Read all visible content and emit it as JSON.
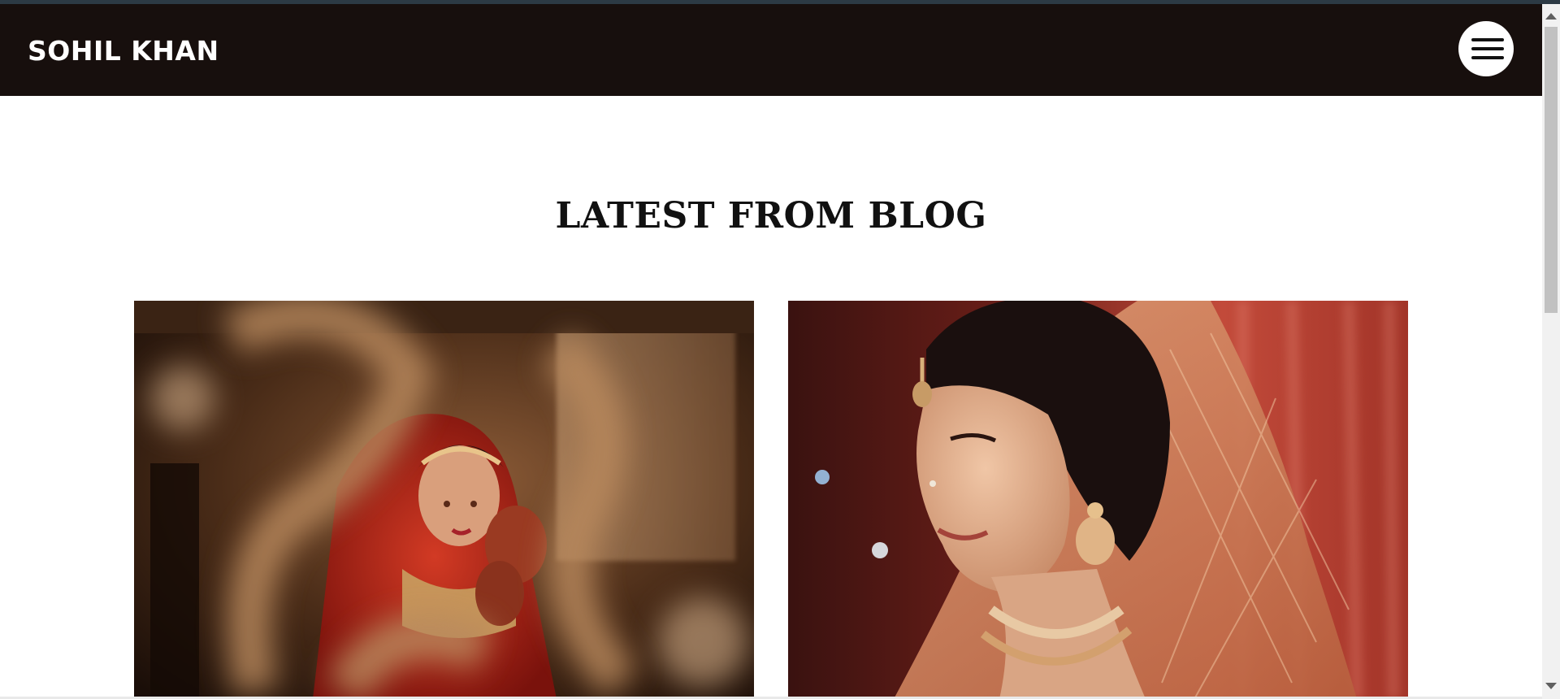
{
  "header": {
    "brand": "SOHIL KHAN",
    "menu_icon": "hamburger-menu-icon"
  },
  "section": {
    "title": "LATEST FROM BLOG"
  },
  "blog_cards": [
    {
      "image": "bride-photo-1"
    },
    {
      "image": "bride-photo-2"
    }
  ],
  "colors": {
    "navbar": "#170f0d",
    "title_text": "#111111",
    "background": "#ffffff"
  }
}
